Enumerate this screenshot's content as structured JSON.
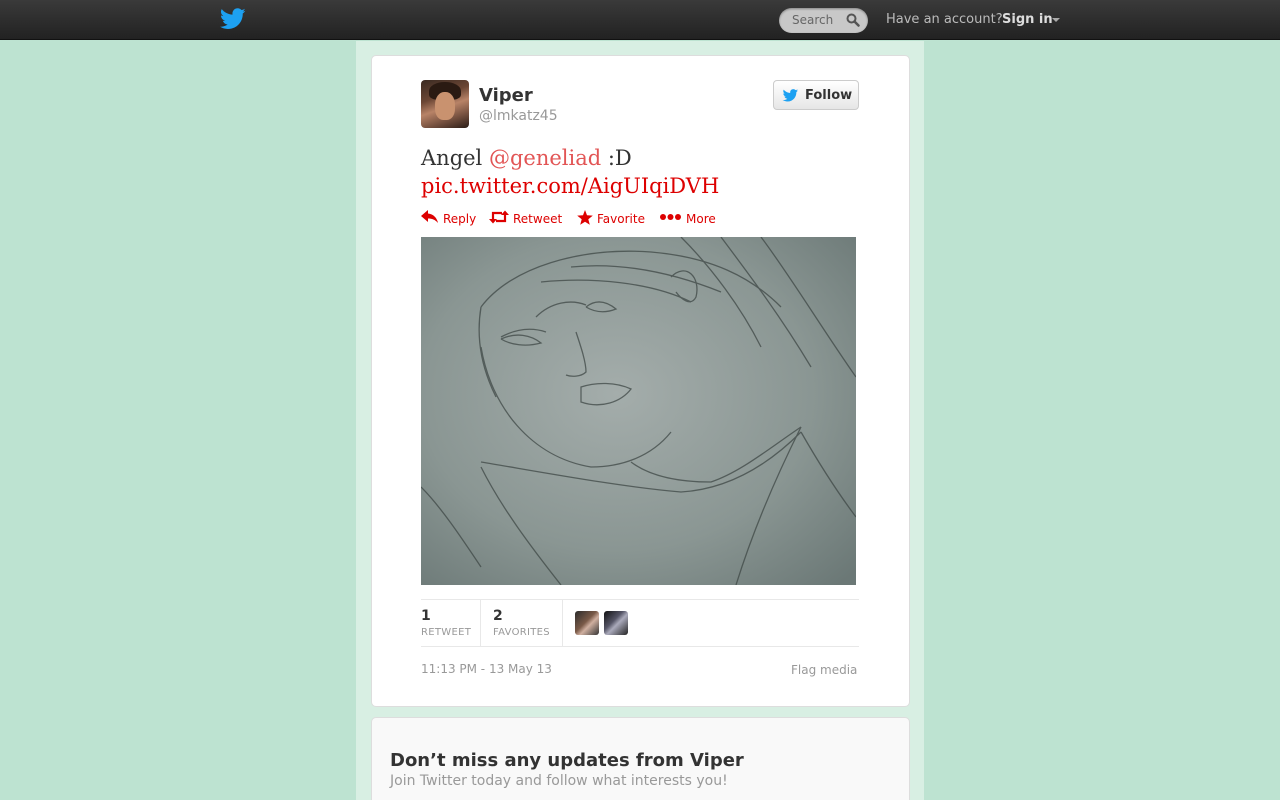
{
  "topbar": {
    "logo_icon": "twitter-bird-icon",
    "search_placeholder": "Search",
    "have_account": "Have an account?",
    "sign_in": "Sign in"
  },
  "tweet": {
    "display_name": "Viper",
    "screen_name": "@lmkatz45",
    "follow_label": "Follow",
    "text_plain": "Angel ",
    "mention": "@geneliad",
    "text_after": " :D",
    "link": "pic.twitter.com/AigUIqiDVH",
    "actions": {
      "reply": "Reply",
      "retweet": "Retweet",
      "favorite": "Favorite",
      "more": "More"
    },
    "retweet_count": "1",
    "retweet_label": "RETWEET",
    "favorite_count": "2",
    "favorite_label": "FAVORITES",
    "timestamp": "11:13 PM - 13 May 13",
    "flag_media": "Flag media"
  },
  "signup": {
    "title": "Don’t miss any updates from Viper",
    "subtitle": "Join Twitter today and follow what interests you!"
  },
  "colors": {
    "background": "#BDE3D1",
    "link": "#DD0000",
    "bird_blue": "#1DA1F2"
  }
}
